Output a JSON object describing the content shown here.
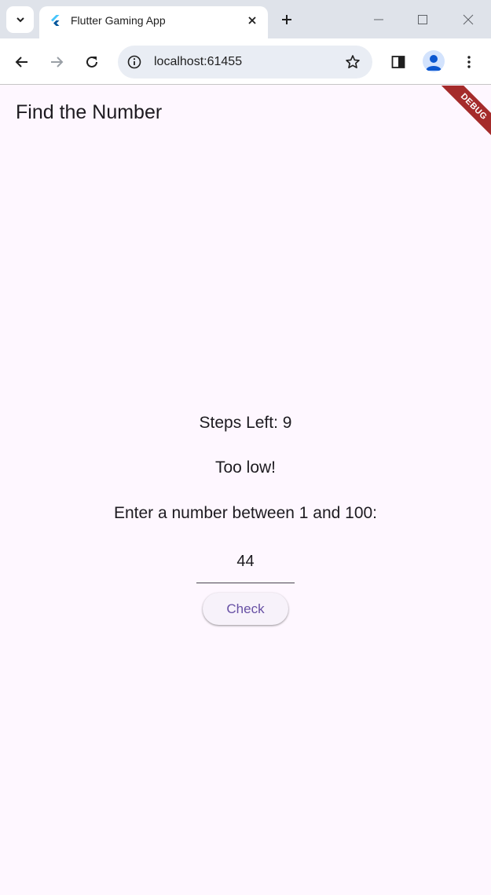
{
  "browser": {
    "tab_title": "Flutter Gaming App",
    "url": "localhost:61455",
    "icons": {
      "tab_search": "chevron-down-icon",
      "favicon": "flutter-logo-icon",
      "tab_close": "close-icon",
      "new_tab": "plus-icon",
      "minimize": "minimize-icon",
      "maximize": "maximize-icon",
      "close_window": "close-icon",
      "back": "back-arrow-icon",
      "forward": "forward-arrow-icon",
      "reload": "reload-icon",
      "site_info": "info-icon",
      "bookmark": "star-icon",
      "side_panel": "side-panel-icon",
      "profile": "profile-icon",
      "menu": "more-vert-icon"
    }
  },
  "app": {
    "title": "Find the Number",
    "debug_banner": "DEBUG",
    "steps_left": "Steps Left: 9",
    "feedback": "Too low!",
    "prompt": "Enter a number between 1 and 100:",
    "input_value": "44",
    "check_label": "Check"
  },
  "colors": {
    "background": "#fef7ff",
    "accent": "#6750a4",
    "debug_banner": "#a52b2b",
    "tabstrip": "#dfe3ea"
  }
}
